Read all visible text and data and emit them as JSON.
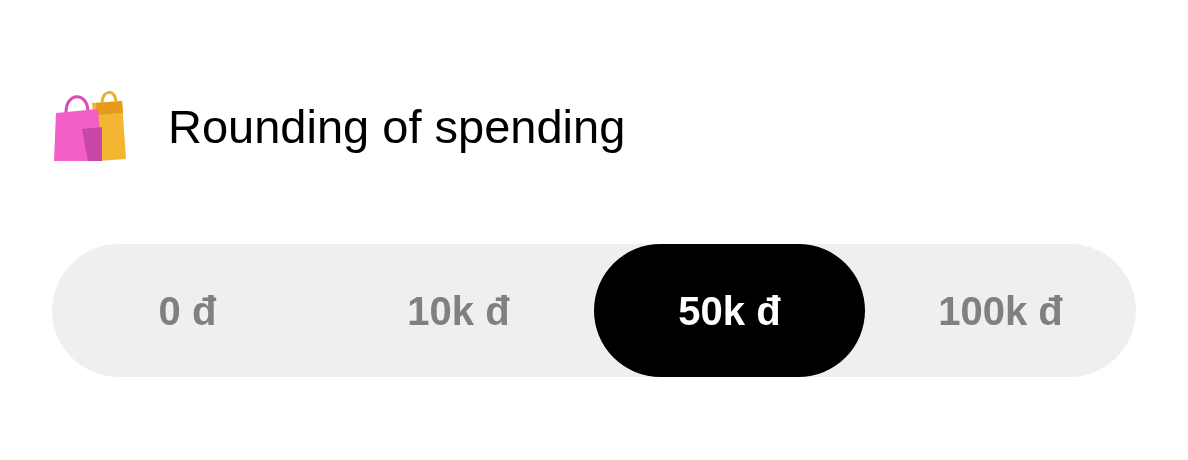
{
  "title": "Rounding of spending",
  "options": [
    {
      "label": "0 đ",
      "selected": false
    },
    {
      "label": "10k đ",
      "selected": false
    },
    {
      "label": "50k đ",
      "selected": true
    },
    {
      "label": "100k đ",
      "selected": false
    }
  ]
}
